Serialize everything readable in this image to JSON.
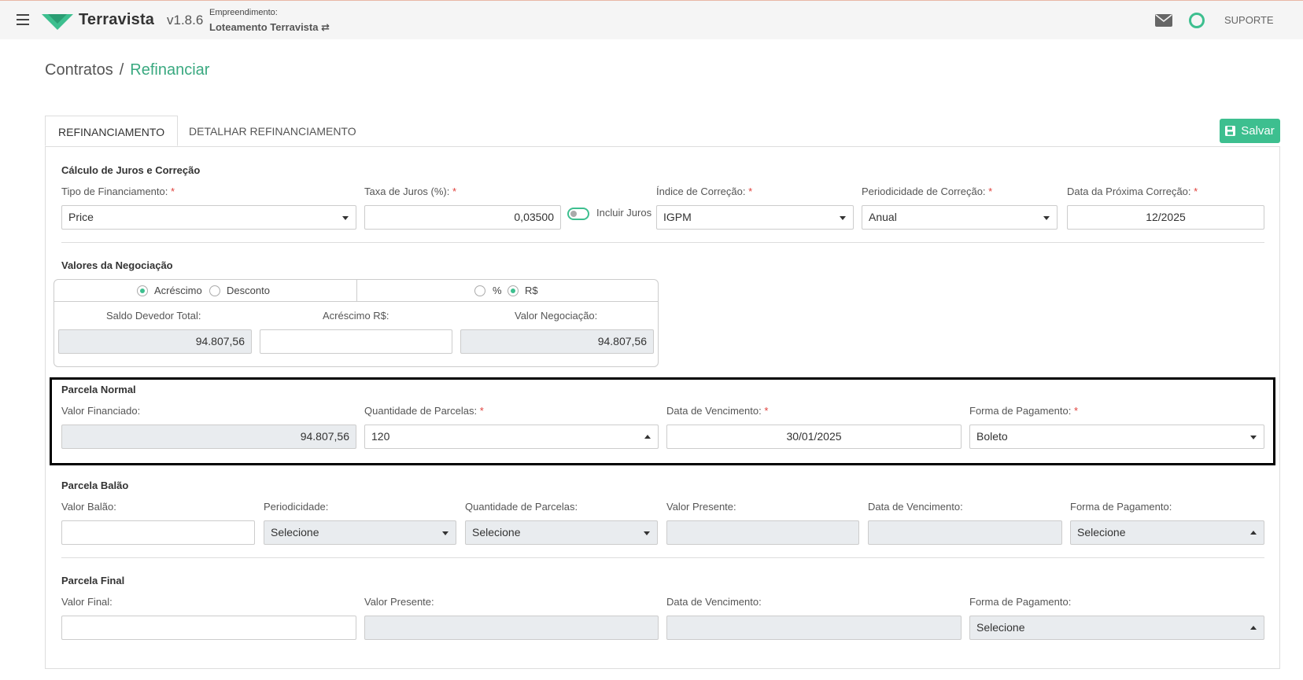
{
  "header": {
    "brand": "Terravista",
    "version": "v1.8.6",
    "empreendimento_label": "Empreendimento:",
    "empreendimento_name": "Loteamento Terravista ⇄",
    "support_label": "SUPORTE",
    "accent_color": "#3dbf8f"
  },
  "breadcrumb": {
    "parent": "Contratos",
    "separator": "/",
    "current": "Refinanciar"
  },
  "tabs": [
    {
      "label": "REFINANCIAMENTO",
      "active": true
    },
    {
      "label": "DETALHAR REFINANCIAMENTO",
      "active": false
    }
  ],
  "save_label": "Salvar",
  "calculo": {
    "title": "Cálculo de Juros e Correção",
    "tipo_label": "Tipo de Financiamento:",
    "tipo_value": "Price",
    "taxa_label": "Taxa de Juros (%):",
    "taxa_value": "0,03500",
    "incluir_juros_label": "Incluir Juros",
    "indice_label": "Índice de Correção:",
    "indice_value": "IGPM",
    "periodicidade_label": "Periodicidade de Correção:",
    "periodicidade_value": "Anual",
    "proxima_label": "Data da Próxima Correção:",
    "proxima_value": "12/2025"
  },
  "negociacao": {
    "title": "Valores da Negociação",
    "acrescimo": "Acréscimo",
    "desconto": "Desconto",
    "percent": "%",
    "reais": "R$",
    "saldo_label": "Saldo Devedor Total:",
    "saldo_value": "94.807,56",
    "acrescimo_rs_label": "Acréscimo R$:",
    "acrescimo_rs_value": "",
    "valor_neg_label": "Valor Negociação:",
    "valor_neg_value": "94.807,56"
  },
  "parcela_normal": {
    "title": "Parcela Normal",
    "valor_label": "Valor Financiado:",
    "valor_value": "94.807,56",
    "qtd_label": "Quantidade de Parcelas:",
    "qtd_value": "120",
    "venc_label": "Data de Vencimento:",
    "venc_value": "30/01/2025",
    "forma_label": "Forma de Pagamento:",
    "forma_value": "Boleto"
  },
  "parcela_balao": {
    "title": "Parcela Balão",
    "valor_label": "Valor Balão:",
    "periodicidade_label": "Periodicidade:",
    "periodicidade_value": "Selecione",
    "qtd_label": "Quantidade de Parcelas:",
    "qtd_value": "Selecione",
    "presente_label": "Valor Presente:",
    "venc_label": "Data de Vencimento:",
    "forma_label": "Forma de Pagamento:",
    "forma_value": "Selecione"
  },
  "parcela_final": {
    "title": "Parcela Final",
    "valor_label": "Valor Final:",
    "presente_label": "Valor Presente:",
    "venc_label": "Data de Vencimento:",
    "forma_label": "Forma de Pagamento:",
    "forma_value": "Selecione"
  }
}
